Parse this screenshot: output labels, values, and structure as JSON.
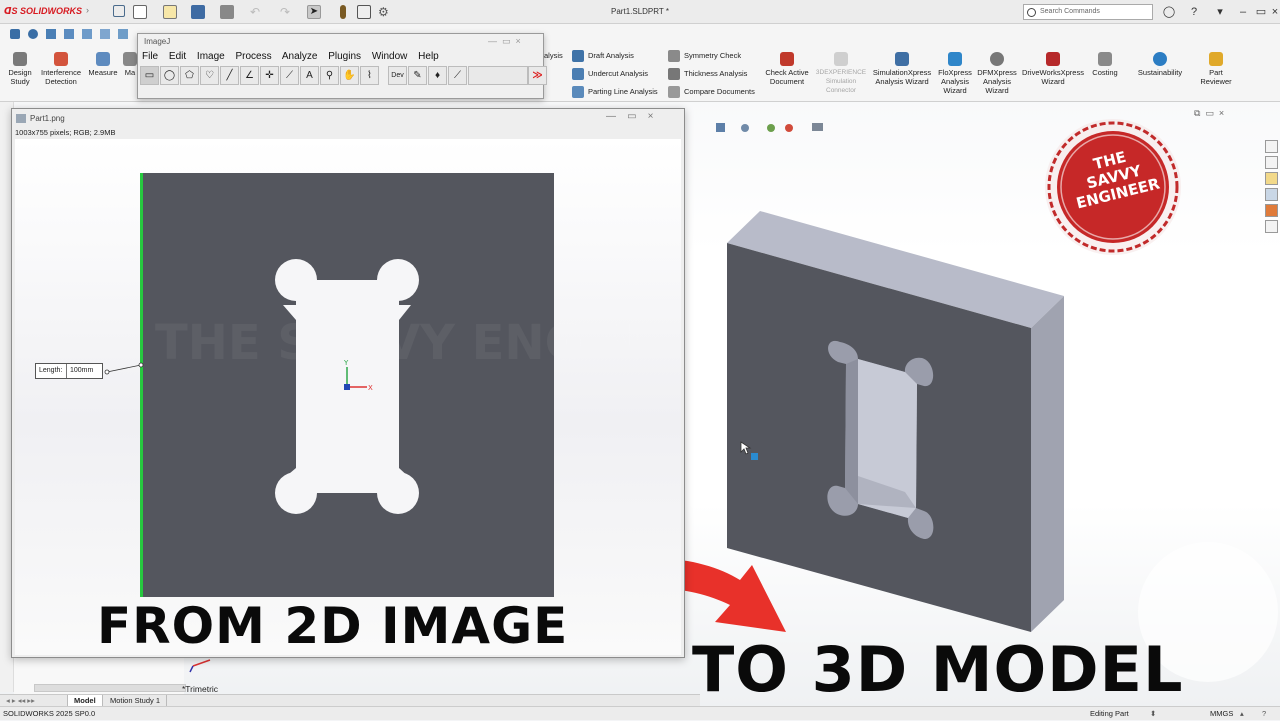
{
  "app": {
    "brand": "SOLIDWORKS",
    "document_title": "Part1.SLDPRT *",
    "search_placeholder": "Search Commands"
  },
  "ribbon": {
    "left_buttons": [
      {
        "label": "Design\nStudy"
      },
      {
        "label": "Interference\nDetection"
      },
      {
        "label": "Measure"
      },
      {
        "label": "Ma"
      }
    ],
    "col1_partial": "alysis",
    "col2": [
      "Draft Analysis",
      "Undercut Analysis",
      "Parting Line Analysis"
    ],
    "col3": [
      "Symmetry Check",
      "Thickness Analysis",
      "Compare Documents"
    ],
    "right_buttons": [
      {
        "label": "Check Active\nDocument",
        "disabled": false
      },
      {
        "label": "3DEXPERIENCE\nSimulation\nConnector",
        "disabled": true
      },
      {
        "label": "SimulationXpress\nAnalysis Wizard",
        "disabled": false
      },
      {
        "label": "FloXpress\nAnalysis\nWizard",
        "disabled": false
      },
      {
        "label": "DFMXpress\nAnalysis\nWizard",
        "disabled": false
      },
      {
        "label": "DriveWorksXpress\nWizard",
        "disabled": false
      },
      {
        "label": "Costing",
        "disabled": false
      },
      {
        "label": "Sustainability",
        "disabled": false
      },
      {
        "label": "Part\nReviewer",
        "disabled": false
      }
    ]
  },
  "imagej": {
    "title": "ImageJ",
    "menu": [
      "File",
      "Edit",
      "Image",
      "Process",
      "Analyze",
      "Plugins",
      "Window",
      "Help"
    ],
    "tools": [
      "rectangle-tool",
      "oval-tool",
      "polygon-tool",
      "freehand-tool",
      "line-tool",
      "angle-tool",
      "point-tool",
      "wand-tool",
      "text-tool",
      "zoom-tool",
      "hand-tool",
      "dropper-tool",
      "dev-tool",
      "pencil-tool",
      "brush-tool",
      "flood-tool",
      "picker-tool",
      "more-tool"
    ],
    "dev_label": "Dev",
    "more_label": "≫"
  },
  "image_window": {
    "title": "Part1.png",
    "info": "1003x755 pixels; RGB; 2.9MB",
    "length_label": "Length:",
    "length_value": "100mm",
    "watermark": "THE SAVVY ENGINEER"
  },
  "viewport": {
    "view_label": "*Trimetric"
  },
  "stamp": {
    "line1": "THE",
    "line2": "SAVVY",
    "line3": "ENGINEER"
  },
  "captions": {
    "left": "FROM 2D IMAGE",
    "right": "TO 3D MODEL"
  },
  "bottom_tabs": [
    "Model",
    "Motion Study 1"
  ],
  "status": {
    "version": "SOLIDWORKS 2025 SP0.0",
    "mode": "Editing Part",
    "units": "MMGS"
  },
  "colors": {
    "brand_red": "#d71920",
    "part_face": "#54565e",
    "part_top": "#b9bcc8",
    "sketch_green": "#27c93f",
    "arrow_red": "#e8312a"
  }
}
